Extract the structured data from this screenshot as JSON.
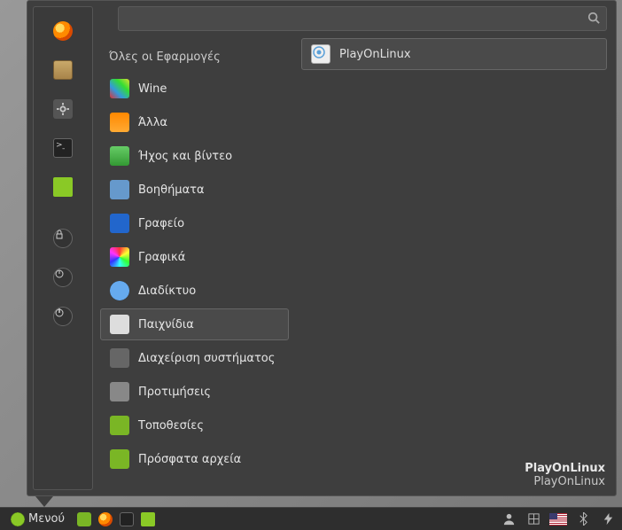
{
  "search": {
    "placeholder": ""
  },
  "categories_header": "Όλες οι Εφαρμογές",
  "categories": [
    {
      "id": "wine",
      "label": "Wine",
      "icon": "wine-icon"
    },
    {
      "id": "other",
      "label": "Άλλα",
      "icon": "other-icon"
    },
    {
      "id": "media",
      "label": "Ήχος και βίντεο",
      "icon": "media-icon"
    },
    {
      "id": "accessories",
      "label": "Βοηθήματα",
      "icon": "calc-icon"
    },
    {
      "id": "office",
      "label": "Γραφείο",
      "icon": "office-icon"
    },
    {
      "id": "graphics",
      "label": "Γραφικά",
      "icon": "graphics-icon"
    },
    {
      "id": "internet",
      "label": "Διαδίκτυο",
      "icon": "internet-icon"
    },
    {
      "id": "games",
      "label": "Παιχνίδια",
      "icon": "games-icon",
      "selected": true
    },
    {
      "id": "system",
      "label": "Διαχείριση συστήματος",
      "icon": "sys-icon"
    },
    {
      "id": "prefs",
      "label": "Προτιμήσεις",
      "icon": "prefs-icon"
    },
    {
      "id": "places",
      "label": "Τοποθεσίες",
      "icon": "places-icon"
    },
    {
      "id": "recent",
      "label": "Πρόσφατα αρχεία",
      "icon": "recent-icon"
    }
  ],
  "apps": [
    {
      "id": "playonlinux",
      "label": "PlayOnLinux",
      "icon": "playonlinux-icon"
    }
  ],
  "app_description": {
    "title": "PlayOnLinux",
    "subtitle": "PlayOnLinux"
  },
  "favorites": [
    {
      "id": "firefox",
      "icon": "firefox-icon"
    },
    {
      "id": "software",
      "icon": "package-icon"
    },
    {
      "id": "settings",
      "icon": "gear-icon"
    },
    {
      "id": "terminal",
      "icon": "terminal-icon"
    },
    {
      "id": "files",
      "icon": "files-icon"
    }
  ],
  "session_buttons": [
    {
      "id": "lock",
      "icon": "lock-icon"
    },
    {
      "id": "logout",
      "icon": "logout-icon"
    },
    {
      "id": "shutdown",
      "icon": "power-icon"
    }
  ],
  "taskbar": {
    "menu_label": "Μενού",
    "launchers": [
      {
        "id": "show-desktop",
        "icon": "show-desktop-icon"
      },
      {
        "id": "firefox",
        "icon": "firefox-icon"
      },
      {
        "id": "terminal",
        "icon": "terminal-icon"
      },
      {
        "id": "files",
        "icon": "files-icon"
      }
    ],
    "tray": [
      {
        "id": "user",
        "icon": "user-icon"
      },
      {
        "id": "network",
        "icon": "network-icon"
      },
      {
        "id": "keyboard",
        "icon": "flag-us-icon"
      },
      {
        "id": "bluetooth",
        "icon": "bluetooth-icon"
      },
      {
        "id": "power-mgr",
        "icon": "power-mgr-icon"
      }
    ]
  }
}
